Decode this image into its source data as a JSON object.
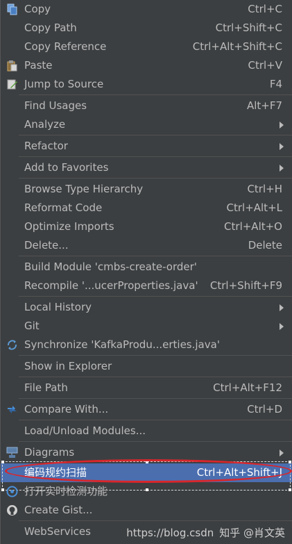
{
  "menu": {
    "items": [
      {
        "label": "Copy",
        "shortcut": "Ctrl+C",
        "icon": "copy-icon"
      },
      {
        "label": "Copy Path",
        "shortcut": "Ctrl+Shift+C"
      },
      {
        "label": "Copy Reference",
        "shortcut": "Ctrl+Alt+Shift+C"
      },
      {
        "label": "Paste",
        "shortcut": "Ctrl+V",
        "icon": "paste-icon"
      },
      {
        "label": "Jump to Source",
        "shortcut": "F4",
        "icon": "edit-icon"
      },
      {
        "label": "Find Usages",
        "shortcut": "Alt+F7"
      },
      {
        "label": "Analyze",
        "shortcut": ""
      },
      {
        "label": "Refactor",
        "shortcut": ""
      },
      {
        "label": "Add to Favorites",
        "shortcut": ""
      },
      {
        "label": "Browse Type Hierarchy",
        "shortcut": "Ctrl+H"
      },
      {
        "label": "Reformat Code",
        "shortcut": "Ctrl+Alt+L"
      },
      {
        "label": "Optimize Imports",
        "shortcut": "Ctrl+Alt+O"
      },
      {
        "label": "Delete...",
        "shortcut": "Delete"
      },
      {
        "label": "Build Module 'cmbs-create-order'",
        "shortcut": ""
      },
      {
        "label": "Recompile '...ucerProperties.java'",
        "shortcut": "Ctrl+Shift+F9"
      },
      {
        "label": "Local History",
        "shortcut": ""
      },
      {
        "label": "Git",
        "shortcut": ""
      },
      {
        "label": "Synchronize 'KafkaProdu...erties.java'",
        "shortcut": "",
        "icon": "sync-icon"
      },
      {
        "label": "Show in Explorer",
        "shortcut": ""
      },
      {
        "label": "File Path",
        "shortcut": "Ctrl+Alt+F12"
      },
      {
        "label": "Compare With...",
        "shortcut": "Ctrl+D",
        "icon": "compare-icon"
      },
      {
        "label": "Load/Unload Modules...",
        "shortcut": ""
      },
      {
        "label": "Diagrams",
        "shortcut": "",
        "icon": "diagram-icon"
      },
      {
        "label": "编码规约扫描",
        "shortcut": "Ctrl+Alt+Shift+J"
      },
      {
        "label": "打开实时检测功能",
        "shortcut": "",
        "icon": "detect-icon"
      },
      {
        "label": "Create Gist...",
        "shortcut": "",
        "icon": "github-icon"
      },
      {
        "label": "WebServices",
        "shortcut": ""
      }
    ]
  },
  "watermark": {
    "url": "https://blog.csdn",
    "zh": "知乎 @肖文英"
  },
  "colors": {
    "background": "#3c3f41",
    "selected": "#4b6eaf",
    "highlight_ellipse": "#d9262b"
  }
}
